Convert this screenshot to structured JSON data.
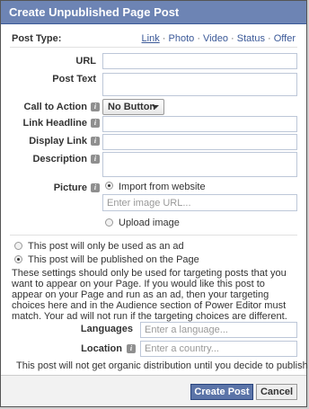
{
  "dialog": {
    "title": "Create Unpublished Page Post"
  },
  "post_type": {
    "label": "Post Type:",
    "options": [
      "Link",
      "Photo",
      "Video",
      "Status",
      "Offer"
    ],
    "separator": " · "
  },
  "fields": {
    "url_label": "URL",
    "post_text_label": "Post Text",
    "cta_label": "Call to Action",
    "cta_value": "No Button",
    "link_headline_label": "Link Headline",
    "display_link_label": "Display Link",
    "description_label": "Description",
    "picture_label": "Picture",
    "import_option": "Import from website",
    "image_url_placeholder": "Enter image URL...",
    "upload_option": "Upload image"
  },
  "publish": {
    "ad_only": "This post will only be used as an ad",
    "on_page": "This post will be published on the Page",
    "note": "These settings should only be used for targeting posts that you want to appear on your Page. If you would like this post to appear on your Page and run as an ad, then your targeting choices here and in the Audience section of Power Editor must match. Your ad will not run if the targeting choices are different."
  },
  "targeting": {
    "languages_label": "Languages",
    "languages_placeholder": "Enter a language...",
    "location_label": "Location",
    "location_placeholder": "Enter a country...",
    "organic_note": "This post will not get organic distribution until you decide to publish it"
  },
  "footer": {
    "create_label": "Create Post",
    "cancel_label": "Cancel"
  },
  "colors": {
    "title_bar": "#6d84b4",
    "link": "#3b5998",
    "primary_button": "#5b74a8"
  },
  "icons": {
    "info": "info-icon",
    "dropdown": "chevron-down-icon"
  }
}
